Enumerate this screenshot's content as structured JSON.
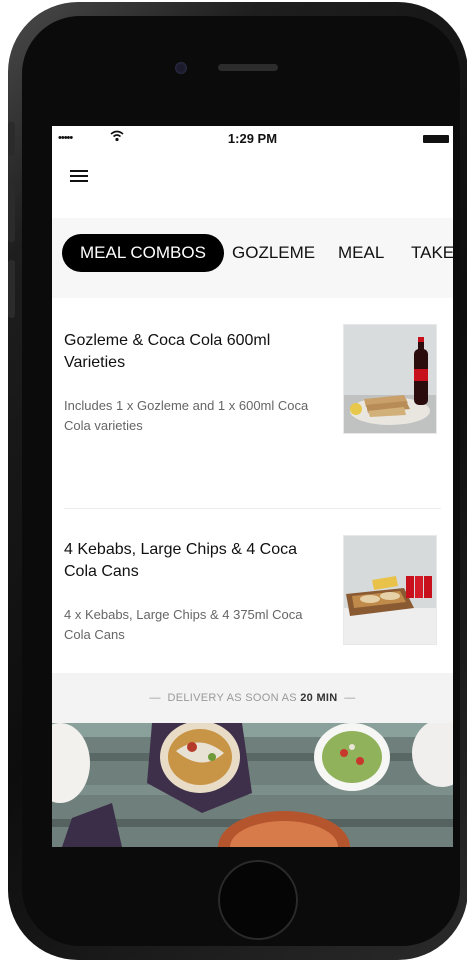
{
  "status_bar": {
    "signal": "•••••",
    "time": "1:29 PM"
  },
  "header": {
    "menu_icon": "hamburger-menu-icon"
  },
  "tabs": [
    {
      "label": "MEAL COMBOS",
      "active": true
    },
    {
      "label": "GOZLEME",
      "active": false
    },
    {
      "label": "MEAL",
      "active": false
    },
    {
      "label": "TAKE",
      "active": false
    }
  ],
  "items": [
    {
      "title": "Gozleme & Coca Cola 600ml Varieties",
      "description": "Includes 1 x Gozleme and 1 x 600ml Coca Cola varieties"
    },
    {
      "title": "4 Kebabs, Large Chips & 4 Coca Cola Cans",
      "description": "4 x Kebabs, Large Chips & 4 375ml Coca Cola Cans"
    }
  ],
  "delivery": {
    "prefix": "DELIVERY AS SOON AS",
    "time": "20 MIN"
  },
  "colors": {
    "active_tab_bg": "#000000",
    "screen_bg": "#ffffff",
    "tab_bar_bg": "#f7f7f7",
    "phone_body": "#111111"
  }
}
